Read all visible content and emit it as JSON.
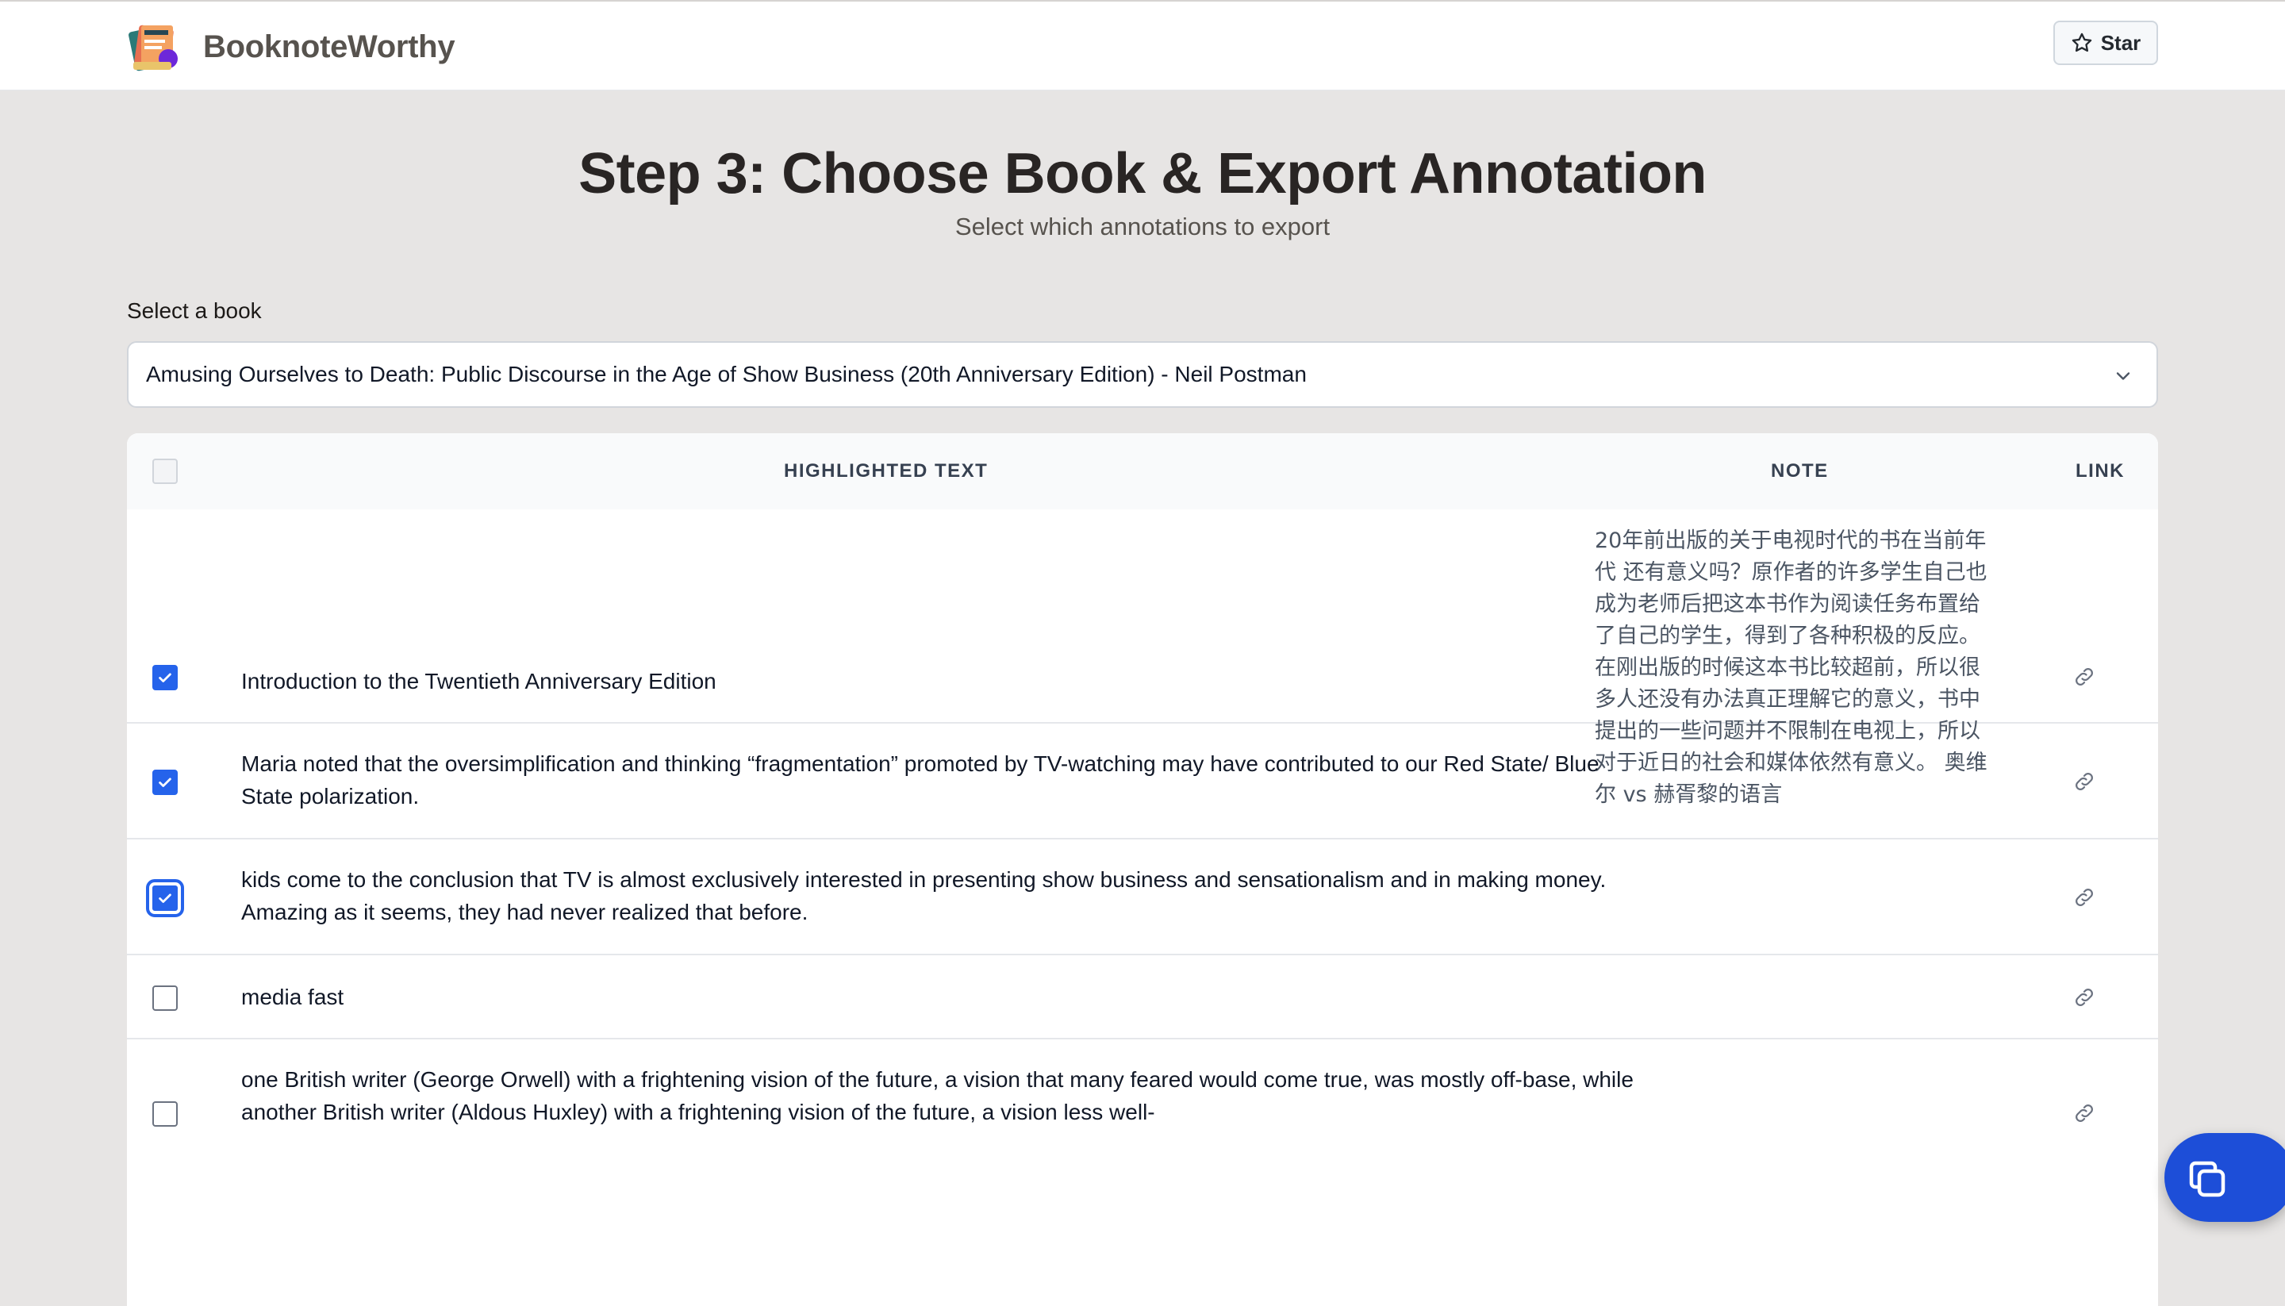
{
  "app": {
    "brand": "BooknoteWorthy",
    "star_label": "Star"
  },
  "page": {
    "title": "Step 3: Choose Book & Export Annotation",
    "subtitle": "Select which annotations to export"
  },
  "book_select": {
    "label": "Select a book",
    "selected": "Amusing Ourselves to Death: Public Discourse in the Age of Show Business (20th Anniversary Edition) - Neil Postman"
  },
  "table": {
    "headers": {
      "highlighted": "HIGHLIGHTED TEXT",
      "note": "NOTE",
      "link": "LINK"
    },
    "rows": [
      {
        "checked": true,
        "text": "Introduction to the Twentieth Anniversary Edition",
        "note": "20年前出版的关于电视时代的书在当前年代 还有意义吗？原作者的许多学生自己也成为老师后把这本书作为阅读任务布置给了自己的学生，得到了各种积极的反应。 在刚出版的时候这本书比较超前，所以很多人还没有办法真正理解它的意义，书中提出的一些问题并不限制在电视上，所以对于近日的社会和媒体依然有意义。 奥维尔 vs 赫胥黎的语言"
      },
      {
        "checked": true,
        "text": "Maria noted that the oversimplification and thinking “fragmentation” promoted by TV-watching may have contributed to our Red State/ Blue State polarization.",
        "note": ""
      },
      {
        "checked": true,
        "focused": true,
        "text": "kids come to the conclusion that TV is almost exclusively interested in presenting show business and sensationalism and in making money. Amazing as it seems, they had never realized that before.",
        "note": ""
      },
      {
        "checked": false,
        "text": "media fast",
        "note": ""
      },
      {
        "checked": false,
        "text": "one British writer (George Orwell) with a frightening vision of the future, a vision that many feared would come true, was mostly off-base, while another British writer (Aldous Huxley) with a frightening vision of the future, a vision less well-",
        "note": ""
      }
    ]
  },
  "colors": {
    "accent": "#2563eb",
    "background": "#e7e5e4"
  },
  "icons": {
    "star": "star-icon",
    "link": "link-icon",
    "chevron": "chevron-down-icon",
    "copy": "copy-icon"
  }
}
